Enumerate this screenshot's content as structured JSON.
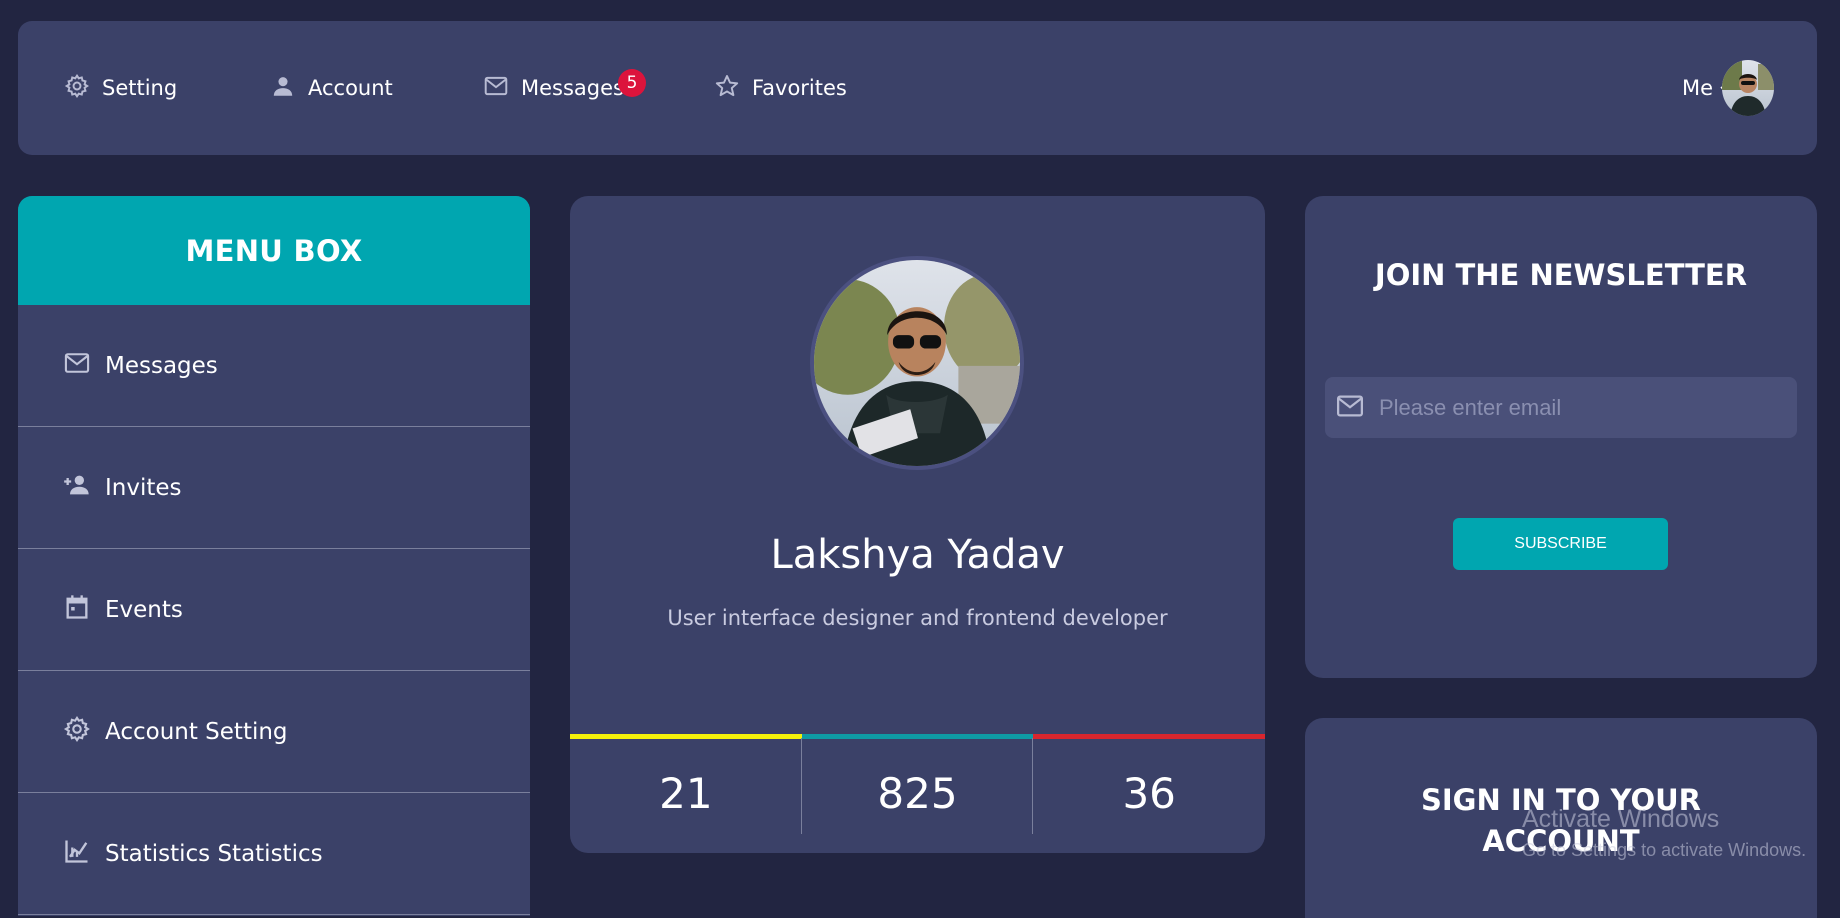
{
  "nav": {
    "items": [
      {
        "label": "Setting",
        "icon": "gear-icon"
      },
      {
        "label": "Account",
        "icon": "person-icon"
      },
      {
        "label": "Messages",
        "icon": "envelope-icon"
      },
      {
        "label": "Favorites",
        "icon": "star-icon"
      }
    ],
    "messages_badge": "5",
    "me_label": "Me"
  },
  "menu": {
    "title": "MENU BOX",
    "items": [
      {
        "label": "Messages",
        "icon": "envelope-icon"
      },
      {
        "label": "Invites",
        "icon": "person-add-icon"
      },
      {
        "label": "Events",
        "icon": "calendar-icon"
      },
      {
        "label": "Account Setting",
        "icon": "gear-icon"
      },
      {
        "label": "Statistics Statistics",
        "icon": "chart-icon"
      }
    ]
  },
  "profile": {
    "name": "Lakshya Yadav",
    "role": "User interface designer and frontend developer",
    "stats": [
      {
        "value": "21",
        "color": "#f5f10a"
      },
      {
        "value": "825",
        "color": "#0f9aa4"
      },
      {
        "value": "36",
        "color": "#d8262e"
      }
    ]
  },
  "newsletter": {
    "title": "JOIN THE NEWSLETTER",
    "email_placeholder": "Please enter email",
    "subscribe_label": "SUBSCRIBE"
  },
  "signin": {
    "title": "SIGN IN TO YOUR ACCOUNT"
  },
  "watermark": {
    "title": "Activate Windows",
    "subtitle": "Go to Settings to activate Windows."
  },
  "colors": {
    "background": "#222541",
    "card": "#3b4168",
    "accent": "#00a6b0",
    "badge": "#dc143c"
  }
}
